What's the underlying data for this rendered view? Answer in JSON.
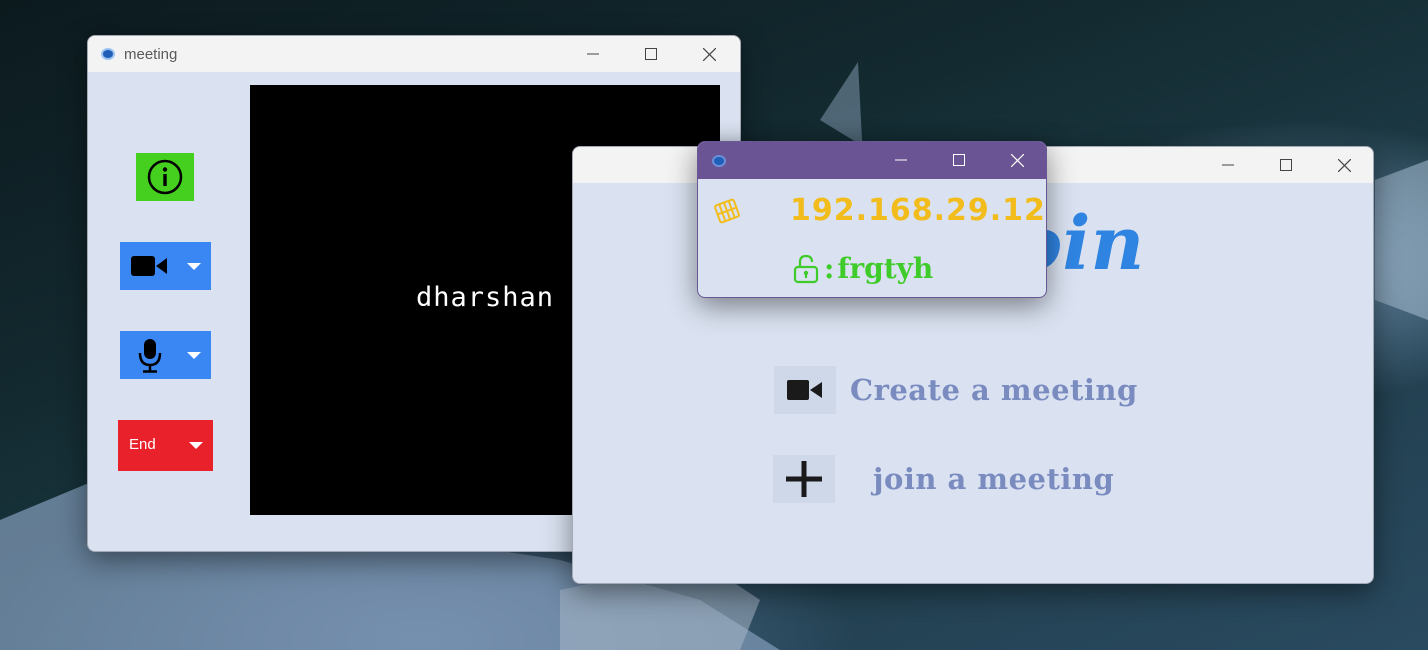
{
  "meeting_window": {
    "title": "meeting",
    "info_button": {
      "icon": "info-icon",
      "color": "#45cf1f"
    },
    "camera_button": {
      "icon": "video-camera-icon",
      "color": "#3a86f2"
    },
    "mic_button": {
      "icon": "microphone-icon",
      "color": "#3a86f2"
    },
    "end_button": {
      "label": "End",
      "color": "#e8212b"
    },
    "video": {
      "participant_name": "dharshan"
    }
  },
  "join_window": {
    "heading": "oin",
    "menu": [
      {
        "label": "Create a meeting",
        "icon": "video-camera-icon"
      },
      {
        "label": "join a meeting",
        "icon": "plus-icon"
      }
    ]
  },
  "info_popup": {
    "ip_address": "192.168.29.12",
    "password_separator": ":",
    "password": "frgtyh",
    "network_icon": "network-chip-icon",
    "lock_icon": "unlock-icon",
    "accent_colors": {
      "ip": "#f2bd1c",
      "password": "#3fcc2b",
      "titlebar": "#6b5494"
    }
  }
}
